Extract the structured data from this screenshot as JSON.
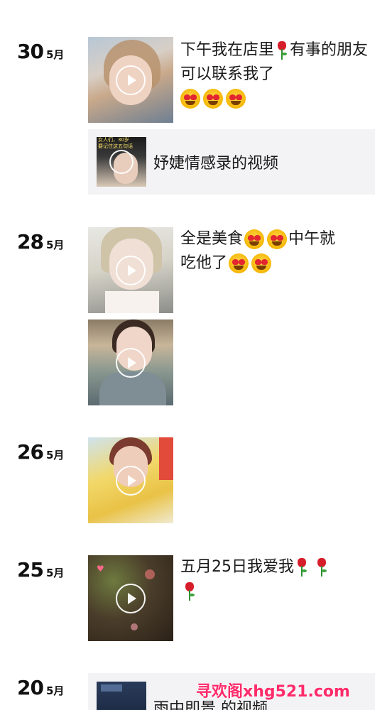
{
  "posts": [
    {
      "day": "30",
      "month": "5月",
      "caption_parts": [
        "下午我在店里",
        "有事的朋友可以联系我了"
      ],
      "shared": {
        "title": "妤婕情感录的视频",
        "overlay_text": "女人们，30岁\n要记住这五句话"
      }
    },
    {
      "day": "28",
      "month": "5月",
      "caption_parts": [
        "全是美食",
        "中午就",
        "吃他了"
      ]
    },
    {
      "day": "26",
      "month": "5月"
    },
    {
      "day": "25",
      "month": "5月",
      "caption_parts": [
        "五月25日我爱我"
      ]
    },
    {
      "day": "20",
      "month": "5月",
      "shared": {
        "title": "雨中即景 的视频"
      }
    }
  ],
  "watermark": "寻欢阁xhg521.com",
  "icons": {
    "play": "play-icon",
    "emoji": "heart-eyes-emoji-icon",
    "rose": "rose-icon"
  },
  "colors": {
    "watermark": "#ff2b6a",
    "share_bg": "#f3f3f5",
    "emoji": "#f4b400",
    "rose": "#d61e2b"
  }
}
